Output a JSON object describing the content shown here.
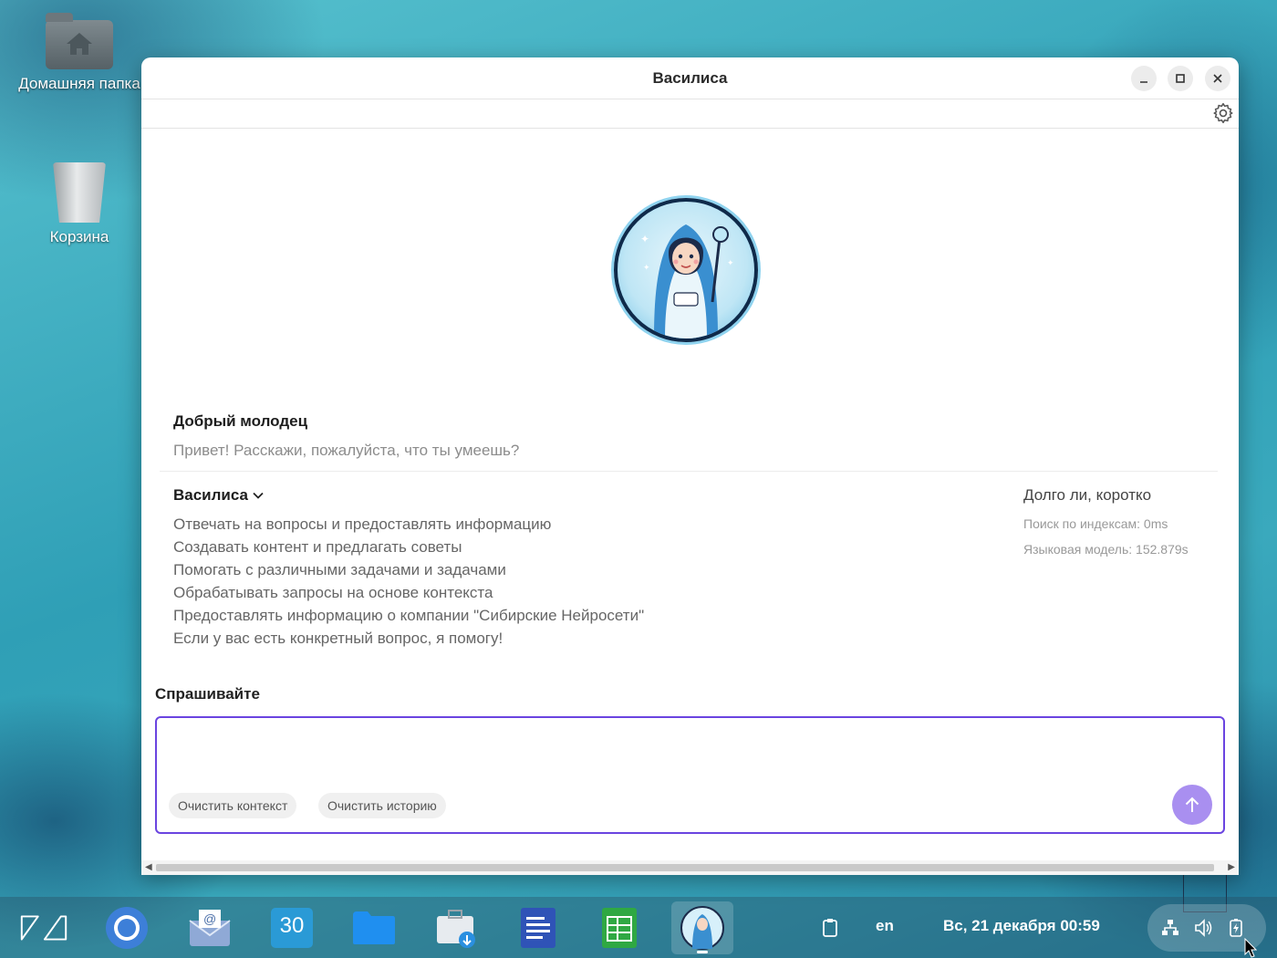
{
  "desktop": {
    "icons": [
      {
        "label": "Домашняя папка"
      },
      {
        "label": "Корзина"
      }
    ]
  },
  "window": {
    "title": "Василиса",
    "controls": {
      "minimize": "–",
      "maximize": "□",
      "close": "✕"
    }
  },
  "chat": {
    "user_message": {
      "author": "Добрый молодец",
      "text": "Привет! Расскажи, пожалуйста, что ты умеешь?"
    },
    "bot_message": {
      "author": "Василиса",
      "lines": [
        "Отвечать на вопросы и предоставлять информацию",
        "Создавать контент и предлагать советы",
        "Помогать с различными задачами и задачами",
        "Обрабатывать запросы на основе контекста",
        "Предоставлять информацию о компании \"Сибирские Нейросети\"",
        "Если у вас есть конкретный вопрос, я помогу!"
      ],
      "meta": {
        "title": "Долго ли, коротко",
        "index_search": "Поиск по индексам: 0ms",
        "language_model": "Языковая модель: 152.879s"
      }
    }
  },
  "composer": {
    "label": "Спрашивайте",
    "value": "",
    "clear_context": "Очистить контекст",
    "clear_history": "Очистить историю"
  },
  "taskbar": {
    "calendar_day": "30",
    "layout": "en",
    "datetime": "Вс, 21 декабря  00:59"
  },
  "colors": {
    "accent": "#6a44e0",
    "send_button": "#a98ff0",
    "window_bg": "#ffffff"
  }
}
